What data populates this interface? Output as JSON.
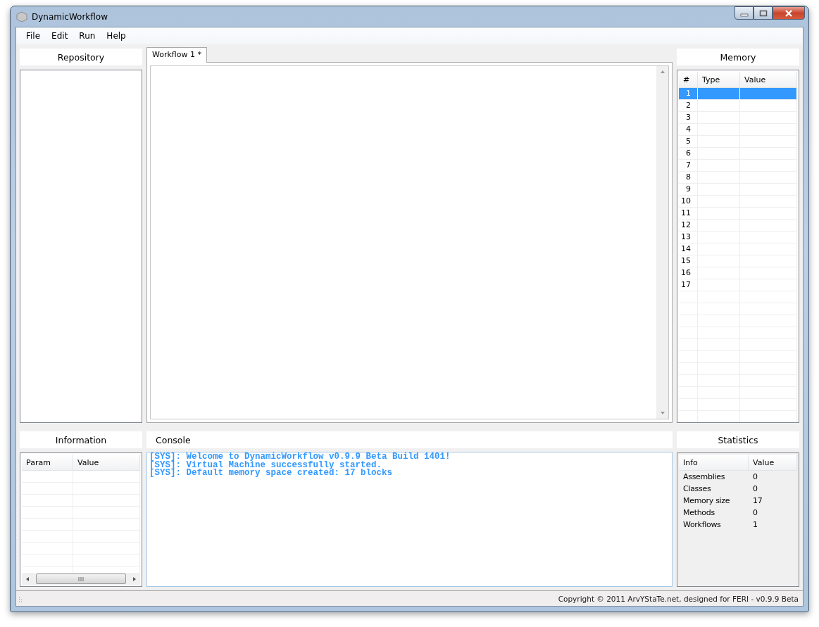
{
  "window": {
    "title": "DynamicWorkflow"
  },
  "menu": [
    "File",
    "Edit",
    "Run",
    "Help"
  ],
  "repository": {
    "title": "Repository"
  },
  "editor": {
    "tabs": [
      {
        "label": "Workflow 1 *",
        "selected": true
      }
    ]
  },
  "memory": {
    "title": "Memory",
    "columns": [
      "#",
      "Type",
      "Value"
    ],
    "rows": [
      {
        "number": "1",
        "selected": true
      },
      {
        "number": "2",
        "selected": false
      },
      {
        "number": "3",
        "selected": false
      },
      {
        "number": "4",
        "selected": false
      },
      {
        "number": "5",
        "selected": false
      },
      {
        "number": "6",
        "selected": false
      },
      {
        "number": "7",
        "selected": false
      },
      {
        "number": "8",
        "selected": false
      },
      {
        "number": "9",
        "selected": false
      },
      {
        "number": "10",
        "selected": false
      },
      {
        "number": "11",
        "selected": false
      },
      {
        "number": "12",
        "selected": false
      },
      {
        "number": "13",
        "selected": false
      },
      {
        "number": "14",
        "selected": false
      },
      {
        "number": "15",
        "selected": false
      },
      {
        "number": "16",
        "selected": false
      },
      {
        "number": "17",
        "selected": false
      }
    ]
  },
  "information": {
    "title": "Information",
    "columns": [
      "Param",
      "Value"
    ]
  },
  "console": {
    "title": "Console",
    "lines": [
      "[SYS]: Welcome to DynamicWorkflow v0.9.9 Beta Build 1401!",
      "[SYS]: Virtual Machine successfully started.",
      "[SYS]: Default memory space created: 17 blocks"
    ]
  },
  "statistics": {
    "title": "Statistics",
    "columns": [
      "Info",
      "Value"
    ],
    "rows": [
      {
        "info": "Assemblies",
        "value": "0"
      },
      {
        "info": "Classes",
        "value": "0"
      },
      {
        "info": "Memory size",
        "value": "17"
      },
      {
        "info": "Methods",
        "value": "0"
      },
      {
        "info": "Workflows",
        "value": "1"
      }
    ]
  },
  "status_bar": {
    "text": "Copyright © 2011 ArvYStaTe.net, designed for FERI - v0.9.9 Beta"
  }
}
